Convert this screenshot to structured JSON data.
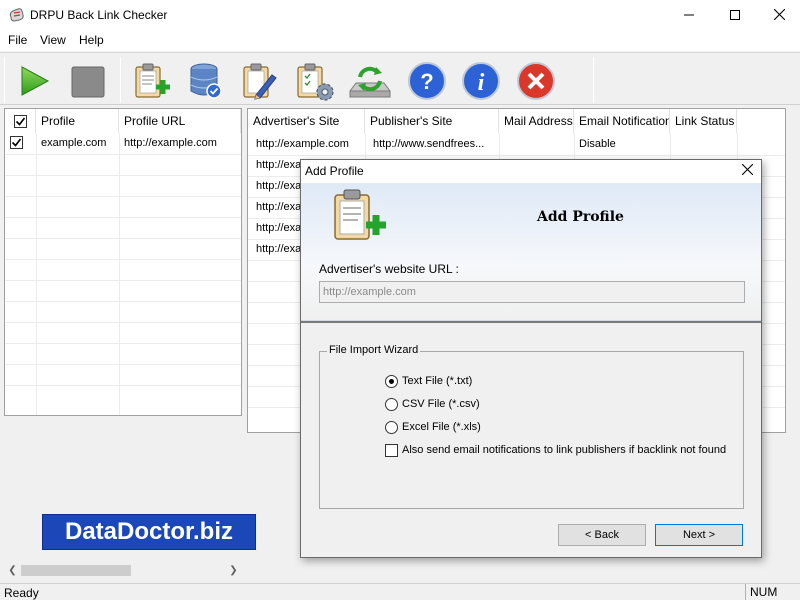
{
  "window": {
    "title": "DRPU Back Link Checker"
  },
  "menu": [
    "File",
    "View",
    "Help"
  ],
  "toolbar": {
    "buttons": [
      "start",
      "stop",
      "add-profile",
      "database",
      "edit-profile",
      "settings",
      "update",
      "help",
      "about",
      "exit"
    ]
  },
  "profiles": {
    "headers": [
      "",
      "Profile",
      "Profile URL"
    ],
    "rows": [
      {
        "checked": true,
        "profile": "example.com",
        "url": "http://example.com"
      }
    ]
  },
  "links": {
    "headers": [
      "Advertiser's Site",
      "Publisher's Site",
      "Mail Address",
      "Email Notification",
      "Link Status"
    ],
    "rows": [
      {
        "advertiser": "http://example.com",
        "publisher": "http://www.sendfrees...",
        "mail": "",
        "notification": "Disable",
        "status": ""
      },
      {
        "advertiser": "http://exa",
        "publisher": "",
        "mail": "",
        "notification": "",
        "status": ""
      },
      {
        "advertiser": "http://exa",
        "publisher": "",
        "mail": "",
        "notification": "",
        "status": ""
      },
      {
        "advertiser": "http://exa",
        "publisher": "",
        "mail": "",
        "notification": "",
        "status": ""
      },
      {
        "advertiser": "http://exa",
        "publisher": "",
        "mail": "",
        "notification": "",
        "status": ""
      },
      {
        "advertiser": "http://exa",
        "publisher": "",
        "mail": "",
        "notification": "",
        "status": ""
      }
    ]
  },
  "dialog": {
    "title": "Add Profile",
    "heading": "Add Profile",
    "url_label": "Advertiser's website URL :",
    "url_placeholder": "http://example.com",
    "group_title": "File Import Wizard",
    "options": [
      {
        "label": "Text File (*.txt)",
        "selected": true
      },
      {
        "label": "CSV File (*.csv)",
        "selected": false
      },
      {
        "label": "Excel File (*.xls)",
        "selected": false
      }
    ],
    "notify_label": "Also send email notifications to link publishers if backlink not found",
    "notify_checked": false,
    "back_label": "< Back",
    "next_label": "Next >"
  },
  "brand": "DataDoctor.biz",
  "status": {
    "left": "Ready",
    "num": "NUM"
  },
  "colors": {
    "brand_bg": "#1b47b8",
    "accent": "#0078d7"
  }
}
